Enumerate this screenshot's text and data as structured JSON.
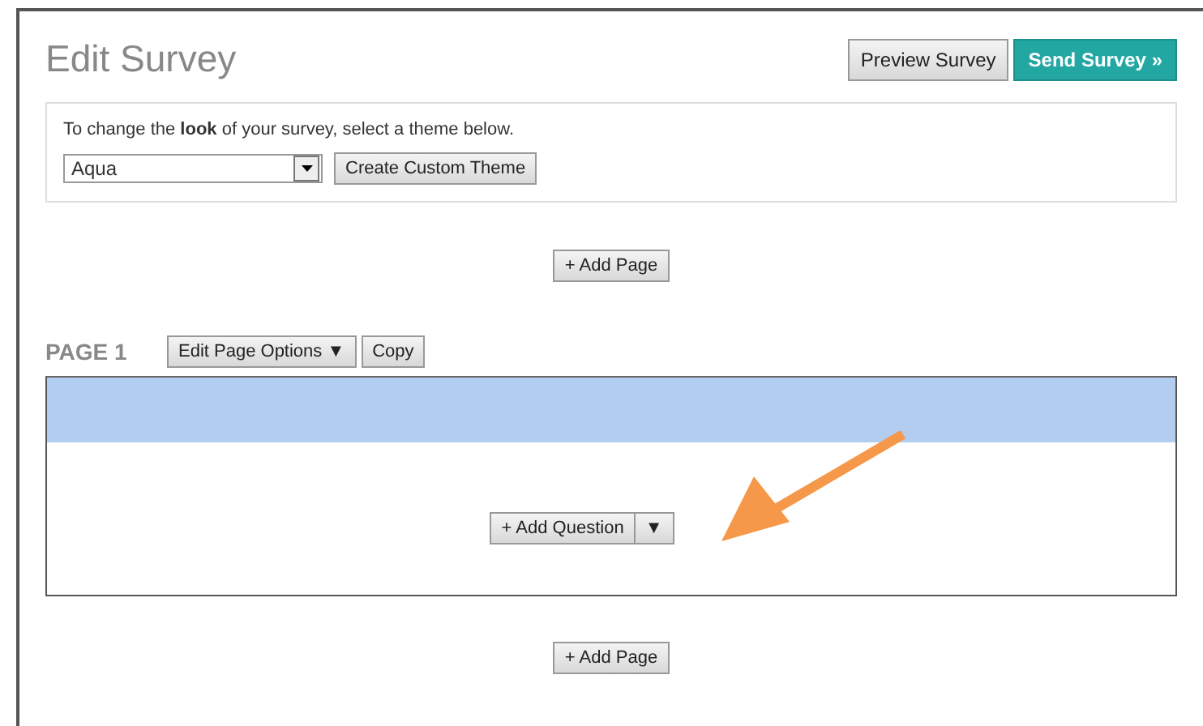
{
  "header": {
    "title": "Edit Survey",
    "buttons": [
      {
        "label": "Preview Survey",
        "kind": "secondary"
      },
      {
        "label": "Send Survey »",
        "kind": "primary"
      }
    ]
  },
  "theme": {
    "instruction": "To change the **look** of your survey, select a theme below.",
    "value": "Aqua",
    "button": "Create Custom Theme"
  },
  "add_page_top": "+ Add Page",
  "page": {
    "title": "PAGE 1",
    "options_button": "Edit Page Options ▼",
    "copy_button": "Copy",
    "add_question": "+ Add Question",
    "add_question_menu": "▼"
  },
  "add_page_bottom": "+ Add Page",
  "annotation": {
    "kind": "arrow"
  }
}
